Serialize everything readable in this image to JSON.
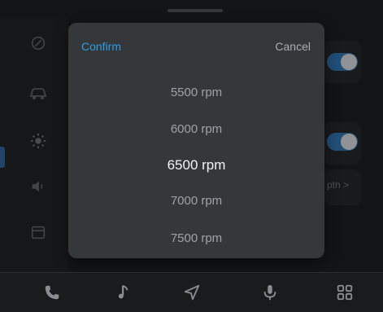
{
  "dialog": {
    "confirm_label": "Confirm",
    "cancel_label": "Cancel",
    "options": [
      "5500 rpm",
      "6000 rpm",
      "6500 rpm",
      "7000 rpm",
      "7500 rpm"
    ],
    "selected_value": "6500 rpm"
  },
  "background": {
    "right_partial_text": "ptn >"
  },
  "sidebar": {
    "icons": [
      "gauge-icon",
      "car-icon",
      "brightness-icon",
      "volume-icon",
      "calendar-icon"
    ]
  },
  "bottom_nav": {
    "icons": [
      "phone-icon",
      "music-icon",
      "navigation-icon",
      "microphone-icon",
      "apps-grid-icon"
    ]
  },
  "colors": {
    "accent": "#2d9be0",
    "toggle_on": "#2f6ea5",
    "dialog_bg": "#35383b"
  }
}
